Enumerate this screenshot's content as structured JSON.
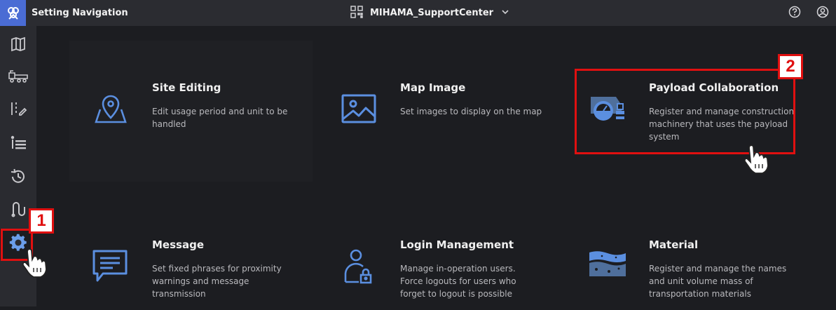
{
  "header": {
    "app_title": "Setting Navigation",
    "site_name": "MIHAMA_SupportCenter",
    "icons": [
      "app-logo-icon",
      "qr-code-icon",
      "chevron-down-icon",
      "help-icon",
      "account-icon"
    ]
  },
  "sidebar": {
    "items": [
      {
        "icon": "map-icon"
      },
      {
        "icon": "truck-icon"
      },
      {
        "icon": "road-edit-icon"
      },
      {
        "icon": "list-icon"
      },
      {
        "icon": "history-icon"
      },
      {
        "icon": "route-icon"
      },
      {
        "icon": "gear-icon",
        "active": true
      }
    ]
  },
  "cards": [
    {
      "title": "Site Editing",
      "description": "Edit usage period and unit to be handled",
      "icon": "site-map-pin-icon"
    },
    {
      "title": "Map Image",
      "description": "Set images to display on the map",
      "icon": "image-icon"
    },
    {
      "title": "Payload Collaboration",
      "description": "Register and manage construction machinery that uses the payload system",
      "icon": "payload-machine-icon"
    },
    {
      "title": "Message",
      "description": "Set fixed phrases for proximity warnings and message transmission",
      "icon": "message-icon"
    },
    {
      "title": "Login Management",
      "description": "Manage in-operation users. Force logouts for users who forget to logout is possible",
      "icon": "user-lock-icon"
    },
    {
      "title": "Material",
      "description": "Register and manage the names and unit volume mass of transportation materials",
      "icon": "material-layers-icon"
    }
  ],
  "annotations": {
    "step1": "1",
    "step2": "2",
    "highlight_color": "#e01010"
  },
  "colors": {
    "accent": "#5b8fe0",
    "topbar": "#2b2c31",
    "sidebar": "#2a2b30",
    "background": "#1c1d21"
  }
}
